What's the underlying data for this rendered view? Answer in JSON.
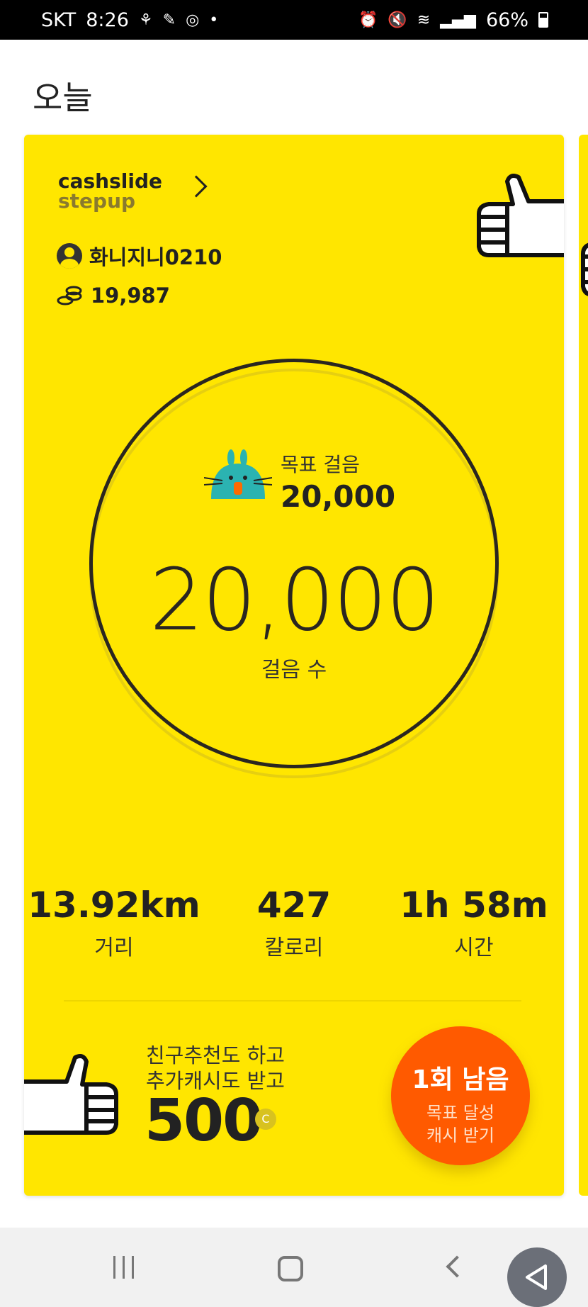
{
  "status_bar": {
    "carrier": "SKT",
    "time": "8:26",
    "battery": "66%",
    "dot": "•"
  },
  "page": {
    "title": "오늘"
  },
  "brand": {
    "line1": "cashslide",
    "line2": "stepup"
  },
  "user": {
    "name": "화니지니0210",
    "coins": "19,987"
  },
  "goal": {
    "label": "목표 걸음",
    "value": "20,000"
  },
  "steps": {
    "value": "20,000",
    "label": "걸음 수"
  },
  "stats": [
    {
      "value": "13.92km",
      "label": "거리"
    },
    {
      "value": "427",
      "label": "칼로리"
    },
    {
      "value": "1h 58m",
      "label": "시간"
    }
  ],
  "promo": {
    "line1": "친구추천도 하고",
    "line2": "추가캐시도 받고",
    "amount": "500",
    "coin_mark": "C"
  },
  "cta": {
    "title": "1회 남음",
    "line1": "목표 달성",
    "line2": "캐시 받기"
  },
  "colors": {
    "card": "#ffe600",
    "cta": "#ff5a00",
    "mascot": "#2bb3b1"
  },
  "icons": [
    "user-icon",
    "coin-stack-icon",
    "thumbs-up-icon",
    "mascot-rabbit-icon",
    "back-triangle-icon"
  ]
}
